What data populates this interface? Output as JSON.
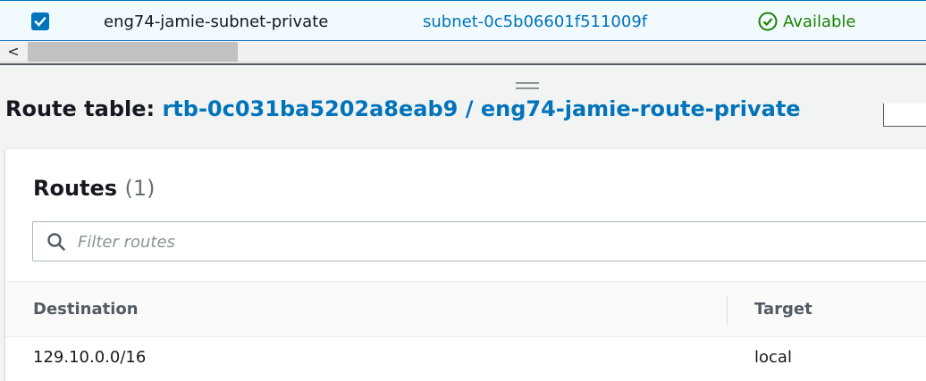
{
  "subnet_row": {
    "selected": true,
    "name": "eng74-jamie-subnet-private",
    "subnet_id": "subnet-0c5b06601f511009f",
    "status": "Available"
  },
  "scrollbar": {
    "left_arrow": "<"
  },
  "route_table": {
    "label": "Route table:",
    "link": "rtb-0c031ba5202a8eab9 / eng74-jamie-route-private"
  },
  "routes": {
    "title": "Routes",
    "count": "(1)",
    "filter_placeholder": "Filter routes",
    "columns": [
      "Destination",
      "Target"
    ],
    "rows": [
      {
        "destination": "129.10.0.0/16",
        "target": "local"
      }
    ]
  },
  "colors": {
    "accent": "#0073bb",
    "status_available": "#1d8102"
  }
}
